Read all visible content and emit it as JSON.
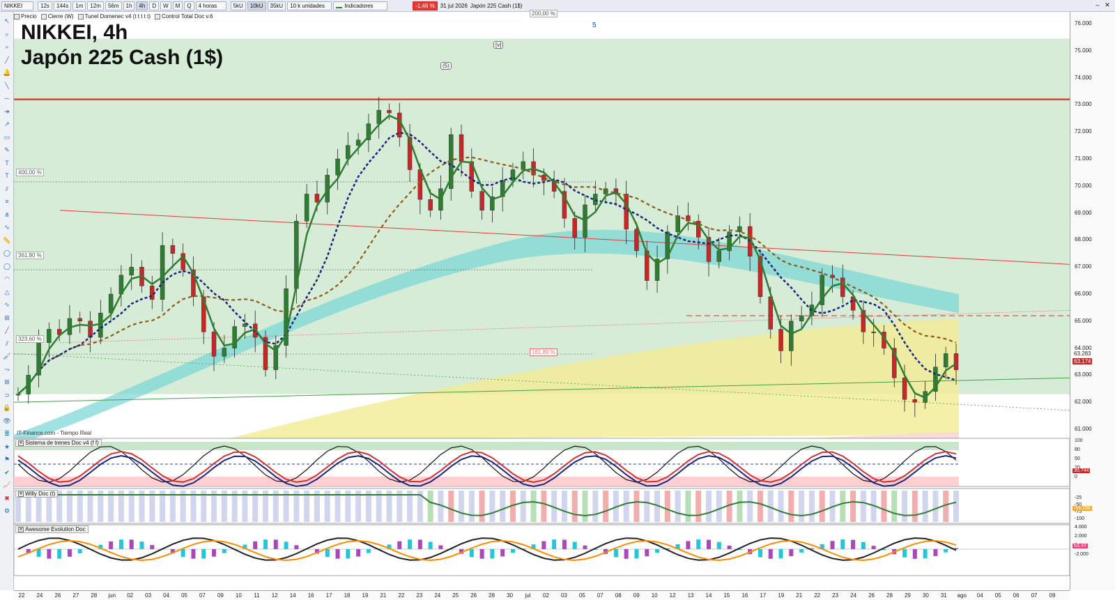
{
  "toolbar": {
    "symbol": "NIKKEI",
    "timeframes": [
      "12s",
      "144s",
      "1m",
      "12m",
      "56m",
      "1h",
      "4h",
      "D",
      "W",
      "M",
      "Q"
    ],
    "active_timeframe": "4h",
    "period_select": "4 horas",
    "volume_buttons": [
      "5kU",
      "10kU",
      "35kU"
    ],
    "active_volume": "10kU",
    "units_select": "10 k unidades",
    "indicators_label": "Indicadores",
    "change_badge": "-1,48 %",
    "date_text": "31 jul 2026",
    "instrument_text": "Japón 225 Cash (1$)"
  },
  "toolbar2": {
    "items": [
      "Precio",
      "Cierre (W)",
      "Tunel Domenec v4 (t t t t t)",
      "Control Total Doc v.6"
    ]
  },
  "chart": {
    "title_line1": "NIKKEI, 4h",
    "title_line2": "Japón 225 Cash (1$)",
    "source_text": "IT-Finance.com - Tiempo Real",
    "fib_labels": [
      "400,00 %",
      "361,80 %",
      "323,60 %",
      "161,80 %",
      "200,00 %"
    ],
    "wave_labels": [
      "(5)",
      "[v]",
      "5"
    ],
    "price_ticks": [
      "76.000",
      "75.000",
      "74.000",
      "73.000",
      "72.000",
      "71.000",
      "70.000",
      "69.000",
      "68.000",
      "67.000",
      "66.000",
      "65.000",
      "64.000",
      "63.000",
      "62.000",
      "61.000"
    ],
    "last_price_tags": [
      "63.283",
      "63.174"
    ],
    "date_ticks": [
      "22",
      "24",
      "26",
      "27",
      "28",
      "jun",
      "02",
      "03",
      "04",
      "05",
      "07",
      "09",
      "10",
      "11",
      "12",
      "14",
      "16",
      "17",
      "18",
      "19",
      "21",
      "22",
      "23",
      "24",
      "25",
      "26",
      "28",
      "30",
      "jul",
      "02",
      "03",
      "05",
      "07",
      "08",
      "09",
      "10",
      "12",
      "13",
      "14",
      "15",
      "16",
      "17",
      "19",
      "21",
      "22",
      "23",
      "24",
      "26",
      "28",
      "29",
      "30",
      "31",
      "ago",
      "04",
      "05",
      "06",
      "07",
      "09"
    ],
    "colors": {
      "bull": "#2e7d32",
      "bear": "#c62828",
      "upper_band": "#78d6d6",
      "yellow_band": "#f2ec9a",
      "green_zone": "#cfe9cf"
    }
  },
  "panes": {
    "trenes": {
      "label": "Sistema de trenes Doc v4 (f f)",
      "ticks": [
        "100",
        "80",
        "50",
        "20",
        "0"
      ],
      "tag": "30,744"
    },
    "willy": {
      "label": "Willy Doc (t)",
      "ticks": [
        "-25",
        "-50",
        "-75",
        "-100"
      ],
      "tag": "-59,296"
    },
    "awesome": {
      "label": "Awesome Evolution Doc",
      "ticks": [
        "4.000",
        "2.000",
        "0",
        "-2.000"
      ],
      "tag": "63,44"
    }
  }
}
